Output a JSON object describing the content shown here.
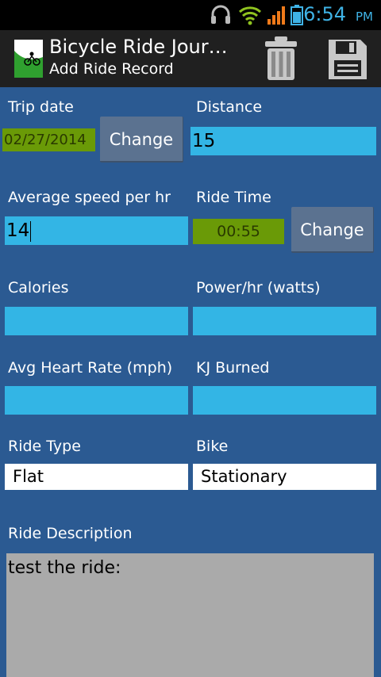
{
  "status_bar": {
    "time": "6:54",
    "ampm": "PM",
    "icons": [
      "headset-icon",
      "wifi-icon",
      "signal-icon",
      "battery-icon"
    ]
  },
  "action_bar": {
    "title": "Bicycle Ride Jour…",
    "subtitle": "Add Ride Record",
    "actions": [
      "trash-icon",
      "save-icon"
    ]
  },
  "form": {
    "trip_date": {
      "label": "Trip date",
      "value": "02/27/2014",
      "button": "Change"
    },
    "distance": {
      "label": "Distance",
      "value": "15"
    },
    "avg_speed": {
      "label": "Average speed per hr",
      "value": "14"
    },
    "ride_time": {
      "label": "Ride Time",
      "value": "00:55",
      "button": "Change"
    },
    "calories": {
      "label": "Calories",
      "value": ""
    },
    "power": {
      "label": "Power/hr (watts)",
      "value": ""
    },
    "heart_rate": {
      "label": "Avg Heart Rate (mph)",
      "value": ""
    },
    "kj_burned": {
      "label": "KJ Burned",
      "value": ""
    },
    "ride_type": {
      "label": "Ride Type",
      "value": "Flat"
    },
    "bike": {
      "label": "Bike",
      "value": "Stationary"
    },
    "description": {
      "label": "Ride Description",
      "value": "test the ride:"
    }
  },
  "colors": {
    "background": "#2b5a92",
    "field": "#33b5e5",
    "date_box": "#6a9a07",
    "status_accent": "#3fb3e6"
  }
}
